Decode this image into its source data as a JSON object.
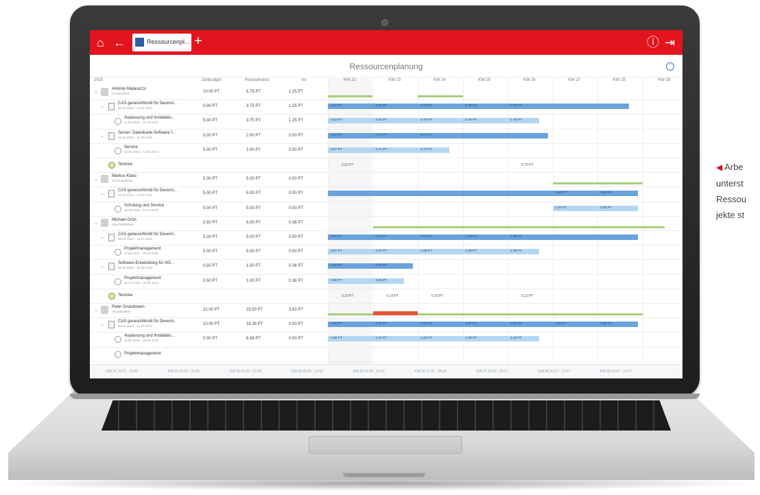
{
  "app": {
    "tab_label": "Ressourcenpl...",
    "title": "Ressourcenplanung"
  },
  "side_caption": [
    "Arbe",
    "unterst",
    "Ressou",
    "jekte st"
  ],
  "columns": {
    "year": "2015",
    "zeitbudget": "Zeitbudget",
    "restaufwand": "Restaufwand",
    "ist": "Ist",
    "weeks": [
      "KW 22",
      "KW 23",
      "KW 24",
      "KW 25",
      "KW 26",
      "KW 27",
      "KW 28",
      "KW 29"
    ]
  },
  "rows": [
    {
      "level": 0,
      "type": "person",
      "name": "Antonio Matarazzo",
      "sub": "Konstrukteur",
      "zb": "10.00 PT",
      "ra": "5.75 PT",
      "ist": "1.25 PT"
    },
    {
      "level": 1,
      "type": "project",
      "name": "CAS genesisWorld für Devemi...",
      "sub": "06.04.2015 – 11.07.2015",
      "zb": "5.00 PT",
      "ra": "3.75 PT",
      "ist": "1.25 PT"
    },
    {
      "level": 2,
      "type": "task",
      "name": "Anpassung und Installatio...",
      "sub": "11.05.2015 – 26.06.2015",
      "zb": "5.00 PT",
      "ra": "3.75 PT",
      "ist": "1.25 PT"
    },
    {
      "level": 1,
      "type": "project",
      "name": "Server: Datenbank-Software f...",
      "sub": "04.05.2015 – 21.06.2015",
      "zb": "5.00 PT",
      "ra": "2.00 PT",
      "ist": "0.00 PT"
    },
    {
      "level": 2,
      "type": "task",
      "name": "Service",
      "sub": "25.05.2015 – 12.06.2015",
      "zb": "5.00 PT",
      "ra": "2.00 PT",
      "ist": "0.00 PT"
    },
    {
      "level": 1,
      "type": "termine",
      "name": "Termine",
      "sub": "",
      "zb": "",
      "ra": "",
      "ist": ""
    },
    {
      "level": 0,
      "type": "person",
      "name": "Markus Klass",
      "sub": "Schulungsleiter",
      "zb": "5.00 PT",
      "ra": "5.00 PT",
      "ist": "0.00 PT"
    },
    {
      "level": 1,
      "type": "project",
      "name": "CAS genesisWorld für Devemi...",
      "sub": "06.04.2015 – 11.07.2015",
      "zb": "5.00 PT",
      "ra": "5.00 PT",
      "ist": "0.00 PT"
    },
    {
      "level": 2,
      "type": "task",
      "name": "Schulung und Service",
      "sub": "29.06.2015 – 10.07.2015",
      "zb": "5.00 PT",
      "ra": "5.00 PT",
      "ist": "0.00 PT"
    },
    {
      "level": 0,
      "type": "person",
      "name": "Michael Grün",
      "sub": "Geschäftsführer",
      "zb": "5.50 PT",
      "ra": "6.00 PT",
      "ist": "0.38 PT"
    },
    {
      "level": 1,
      "type": "project",
      "name": "CAS genesisWorld für Devemi...",
      "sub": "06.04.2015 – 11.07.2015",
      "zb": "5.00 PT",
      "ra": "5.00 PT",
      "ist": "0.00 PT"
    },
    {
      "level": 2,
      "type": "task",
      "name": "Projektmanagement",
      "sub": "11.05.2015 – 26.06.2015",
      "zb": "5.00 PT",
      "ra": "5.00 PT",
      "ist": "0.00 PT"
    },
    {
      "level": 1,
      "type": "project",
      "name": "Software-Entwicklung für NO...",
      "sub": "09.05.2015 – 06.06.2015",
      "zb": "0.50 PT",
      "ra": "1.00 PT",
      "ist": "0.38 PT"
    },
    {
      "level": 2,
      "type": "task",
      "name": "Projektmanagement",
      "sub": "20.04.2015 – 05.06.2015",
      "zb": "0.50 PT",
      "ra": "1.00 PT",
      "ist": "0.38 PT"
    },
    {
      "level": 1,
      "type": "termine",
      "name": "Termine",
      "sub": "",
      "zb": "",
      "ra": "",
      "ist": ""
    },
    {
      "level": 0,
      "type": "person",
      "name": "Peter Grundmann",
      "sub": "Vertriebsleiter",
      "zb": "21.00 PT",
      "ra": "23.50 PT",
      "ist": "3.63 PT"
    },
    {
      "level": 1,
      "type": "project",
      "name": "CAS genesisWorld für Devemi...",
      "sub": "06.04.2015 – 11.07.2015",
      "zb": "10.00 PT",
      "ra": "16.38 PT",
      "ist": "0.00 PT"
    },
    {
      "level": 2,
      "type": "task",
      "name": "Anpassung und Installatio...",
      "sub": "11.05.2015 – 26.06.2015",
      "zb": "0.00 PT",
      "ra": "6.38 PT",
      "ist": "0.00 PT"
    },
    {
      "level": 2,
      "type": "task",
      "name": "Projektmanagement",
      "sub": "",
      "zb": "",
      "ra": "",
      "ist": ""
    }
  ],
  "week_bar": [
    {
      "kw": "KW 21",
      "range": "18.05 - 24.05"
    },
    {
      "kw": "KW 22",
      "range": "25.05 - 31.05"
    },
    {
      "kw": "KW 23",
      "range": "01.06 - 07.06"
    },
    {
      "kw": "KW 24",
      "range": "08.06 - 14.06"
    },
    {
      "kw": "KW 25",
      "range": "15.06 - 21.06"
    },
    {
      "kw": "KW 26",
      "range": "22.06 - 28.06"
    },
    {
      "kw": "KW 27",
      "range": "29.06 - 05.07"
    },
    {
      "kw": "KW 28",
      "range": "06.07 - 12.07"
    },
    {
      "kw": "KW 29",
      "range": "13.07 - 19.07"
    }
  ],
  "gantt": [
    {
      "row": 0,
      "green": [
        [
          0,
          0.99
        ],
        [
          2,
          3.0
        ]
      ]
    },
    {
      "row": 1,
      "bar": "dark",
      "span": [
        0,
        6.7
      ],
      "labels": [
        "0.63 PT",
        "0.78 PT",
        "0.78 PT",
        "0.78 PT",
        "0.78 PT"
      ]
    },
    {
      "row": 2,
      "bar": "light",
      "span": [
        0,
        4.7
      ],
      "labels": [
        "0.63 PT",
        "0.78 PT",
        "0.78 PT",
        "0.78 PT",
        "0.78 PT"
      ]
    },
    {
      "row": 3,
      "bar": "dark",
      "span": [
        0,
        4.9
      ],
      "labels": [
        "0.57 PT",
        "0.71 PT",
        "0.71 PT"
      ]
    },
    {
      "row": 4,
      "bar": "light",
      "span": [
        0,
        2.7
      ],
      "labels": [
        "0.57 PT",
        "0.71 PT",
        "0.71 PT"
      ]
    },
    {
      "row": 5,
      "text": [
        "0.62 PT",
        "",
        "",
        "",
        "0.75 PT"
      ]
    },
    {
      "row": 6,
      "green": [
        [
          5,
          7.0
        ]
      ]
    },
    {
      "row": 7,
      "bar": "dark",
      "span": [
        0,
        6.9
      ],
      "labels": [
        "",
        "",
        "",
        "",
        "",
        "2.50 PT",
        "2.50 PT"
      ]
    },
    {
      "row": 8,
      "bar": "light",
      "span": [
        5,
        6.9
      ],
      "labels": [
        "",
        "",
        "",
        "",
        "",
        "2.50 PT",
        "2.50 PT"
      ]
    },
    {
      "row": 9,
      "green": [
        [
          1,
          2.0
        ],
        [
          2,
          7.5
        ]
      ]
    },
    {
      "row": 10,
      "bar": "dark",
      "span": [
        0,
        6.9
      ],
      "labels": [
        "0.87 PT",
        "0.87 PT",
        "1.09 PT",
        "1.09 PT",
        "1.09 PT"
      ]
    },
    {
      "row": 11,
      "bar": "light",
      "span": [
        0,
        4.7
      ],
      "labels": [
        "0.87 PT",
        "0.87 PT",
        "1.09 PT",
        "1.09 PT",
        "1.09 PT"
      ]
    },
    {
      "row": 12,
      "bar": "dark",
      "span": [
        0,
        1.9
      ],
      "labels": [
        "0.50 PT",
        "0.50 PT"
      ]
    },
    {
      "row": 13,
      "bar": "light",
      "span": [
        0,
        1.7
      ],
      "labels": [
        "0.50 PT",
        "0.50 PT"
      ]
    },
    {
      "row": 14,
      "text": [
        "0.19 PT",
        "0.19 PT",
        "0.19 PT",
        "",
        "0.12 PT"
      ]
    },
    {
      "row": 15,
      "green": [
        [
          0,
          7.0
        ]
      ],
      "red": [
        1,
        2.0
      ]
    },
    {
      "row": 16,
      "bar": "dark",
      "span": [
        0,
        6.9
      ],
      "labels": [
        "1.90 PT",
        "2.37 PT",
        "2.37 PT",
        "2.37 PT",
        "2.37 PT",
        "2.50 PT",
        "2.50 PT"
      ]
    },
    {
      "row": 17,
      "bar": "light",
      "span": [
        0,
        4.7
      ],
      "labels": [
        "1.06 PT",
        "1.33 PT",
        "1.33 PT",
        "1.33 PT",
        "1.33 PT"
      ]
    }
  ],
  "colors": {
    "brand": "#e3141e",
    "bar_dark": "#6aa3dc",
    "bar_light": "#b3d6f2",
    "green": "#a5cf7a",
    "over": "#e5573c"
  }
}
